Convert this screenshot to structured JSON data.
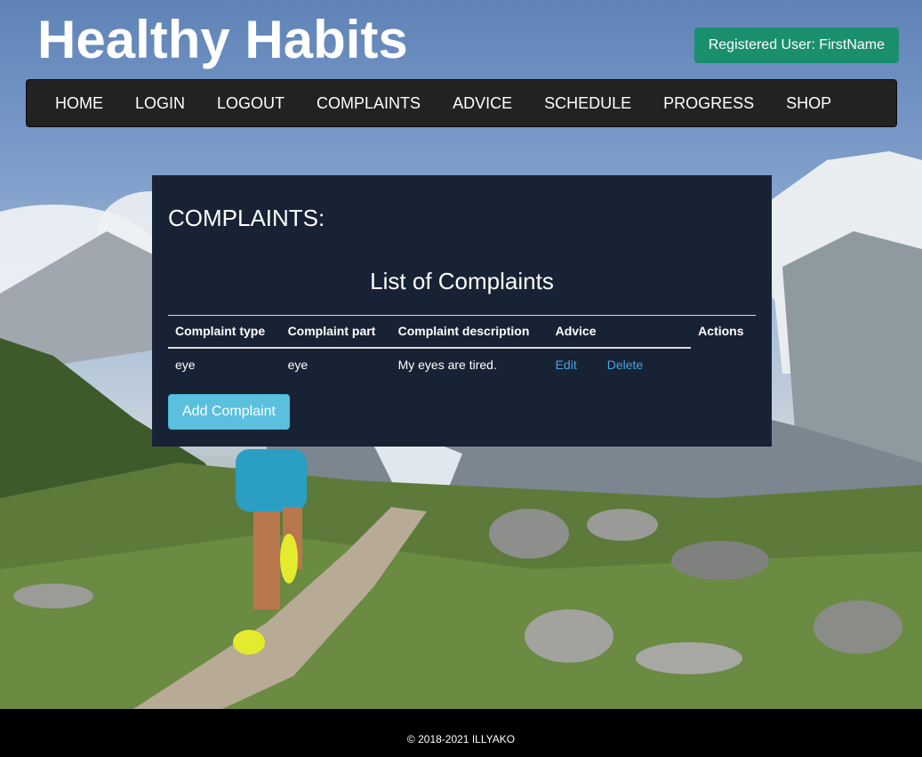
{
  "header": {
    "brand": "Healthy Habits",
    "user_badge": "Registered User: FirstName"
  },
  "nav": {
    "items": [
      {
        "label": "HOME"
      },
      {
        "label": "LOGIN"
      },
      {
        "label": "LOGOUT"
      },
      {
        "label": "COMPLAINTS"
      },
      {
        "label": "ADVICE"
      },
      {
        "label": "SCHEDULE"
      },
      {
        "label": "PROGRESS"
      },
      {
        "label": "SHOP"
      }
    ]
  },
  "main": {
    "title": "COMPLAINTS:",
    "caption": "List of Complaints",
    "columns": [
      "Complaint type",
      "Complaint part",
      "Complaint description",
      "Advice",
      "Actions"
    ],
    "rows": [
      {
        "type": "eye",
        "part": "eye",
        "description": "My eyes are tired.",
        "edit_label": "Edit",
        "delete_label": "Delete"
      }
    ],
    "add_button": "Add Complaint"
  },
  "footer": {
    "copyright": "© 2018-2021 ILLYAKO"
  },
  "colors": {
    "navbar": "#222222",
    "panel": "#172234",
    "user_badge": "#1a8f6e",
    "add_button": "#5bc0de",
    "link": "#4aa3e2"
  }
}
